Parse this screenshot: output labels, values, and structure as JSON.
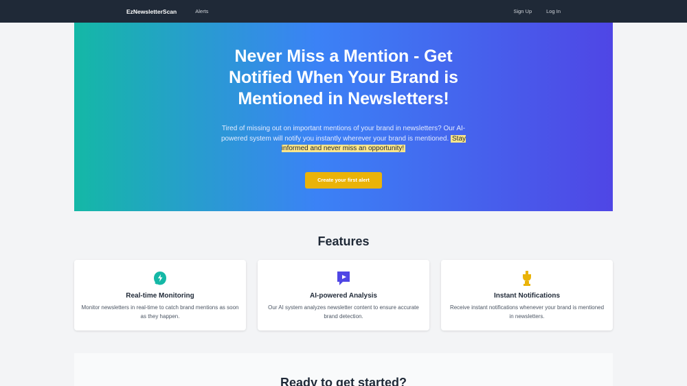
{
  "nav": {
    "brand": "EzNewsletterScan",
    "links": [
      {
        "label": "Alerts"
      }
    ],
    "auth": [
      {
        "label": "Sign Up"
      },
      {
        "label": "Log In"
      }
    ]
  },
  "hero": {
    "title": "Never Miss a Mention - Get Notified When Your Brand is Mentioned in Newsletters!",
    "description": "Tired of missing out on important mentions of your brand in newsletters? Our AI-powered system will notify you instantly wherever your brand is mentioned.",
    "highlight": "Stay informed and never miss an opportunity!",
    "cta_label": "Create your first alert"
  },
  "features": {
    "heading": "Features",
    "items": [
      {
        "icon": "refresh-monitor-icon",
        "icon_color": "#14b8a6",
        "title": "Real-time Monitoring",
        "description": "Monitor newsletters in real-time to catch brand mentions as soon as they happen."
      },
      {
        "icon": "chat-play-icon",
        "icon_color": "#4f46e5",
        "title": "AI-powered Analysis",
        "description": "Our AI system analyzes newsletter content to ensure accurate brand detection."
      },
      {
        "icon": "trophy-icon",
        "icon_color": "#eab308",
        "title": "Instant Notifications",
        "description": "Receive instant notifications whenever your brand is mentioned in newsletters."
      }
    ]
  },
  "ready": {
    "heading": "Ready to get started?"
  },
  "colors": {
    "nav_bg": "#1f2937",
    "accent_yellow": "#eab308",
    "highlight": "#fde68a",
    "gradient_start": "#14b8a6",
    "gradient_end": "#4f46e5"
  }
}
